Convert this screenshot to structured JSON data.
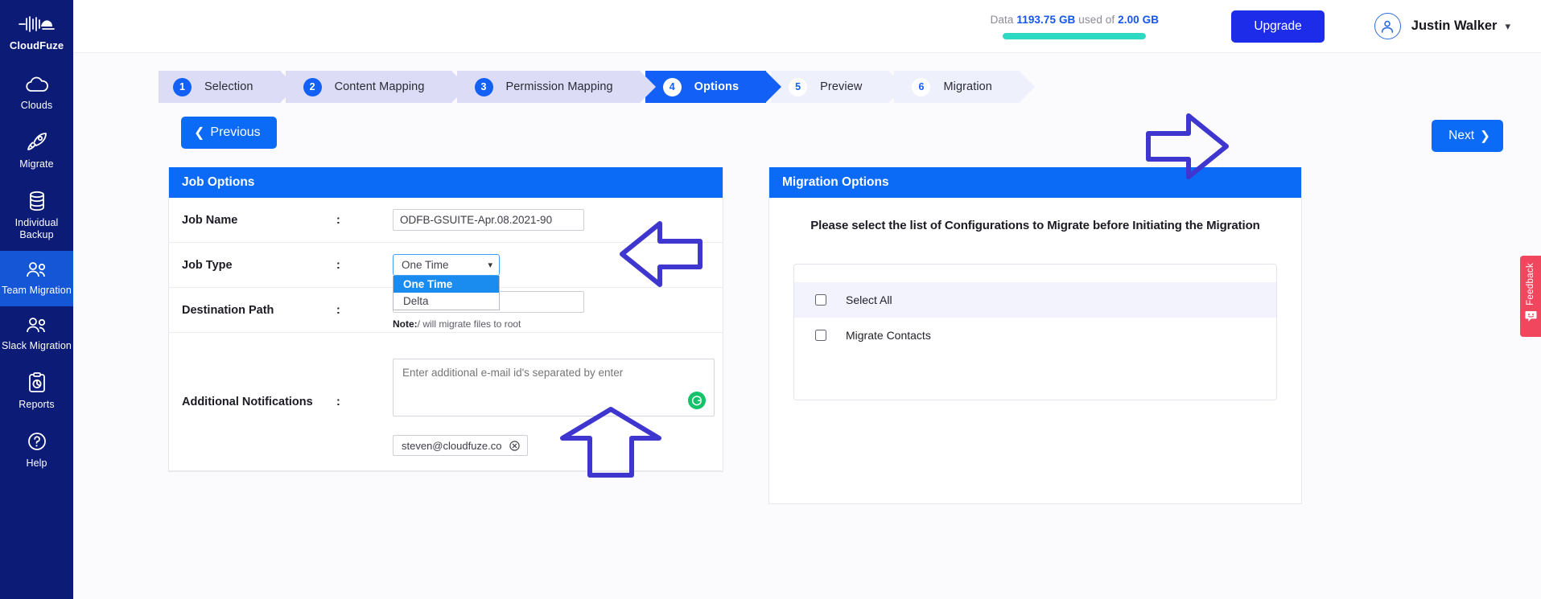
{
  "sidebar": {
    "brand": {
      "label": "CloudFuze",
      "icon": "cloudfuze-logo-icon"
    },
    "items": [
      {
        "label": "Clouds",
        "icon": "cloud-icon",
        "active": false
      },
      {
        "label": "Migrate",
        "icon": "rocket-icon",
        "active": false
      },
      {
        "label": "Individual Backup",
        "icon": "database-icon",
        "active": false
      },
      {
        "label": "Team Migration",
        "icon": "team-icon",
        "active": true
      },
      {
        "label": "Slack Migration",
        "icon": "team-icon",
        "active": false
      },
      {
        "label": "Reports",
        "icon": "clipboard-chart-icon",
        "active": false
      },
      {
        "label": "Help",
        "icon": "question-circle-icon",
        "active": false
      }
    ]
  },
  "header": {
    "data_prefix": "Data",
    "data_used": "1193.75 GB",
    "data_middle": "used of",
    "data_total": "2.00 GB",
    "progress_percent": 100,
    "upgrade_label": "Upgrade",
    "user_name": "Justin Walker",
    "avatar_icon": "user-avatar-icon",
    "caret_icon": "chevron-down-icon",
    "accent_color": "#1456f0",
    "progress_color": "#2ed9c3",
    "upgrade_color": "#1c2ce8"
  },
  "stepper": {
    "steps": [
      {
        "num": "1",
        "label": "Selection",
        "state": "done"
      },
      {
        "num": "2",
        "label": "Content Mapping",
        "state": "done"
      },
      {
        "num": "3",
        "label": "Permission Mapping",
        "state": "done"
      },
      {
        "num": "4",
        "label": "Options",
        "state": "active"
      },
      {
        "num": "5",
        "label": "Preview",
        "state": "pending"
      },
      {
        "num": "6",
        "label": "Migration",
        "state": "pending"
      }
    ]
  },
  "nav": {
    "previous_label": "Previous",
    "next_label": "Next",
    "prev_icon": "chevron-left-icon",
    "next_icon": "chevron-right-icon"
  },
  "job_options": {
    "title": "Job Options",
    "colon": ":",
    "rows": {
      "job_name": {
        "label": "Job Name",
        "value": "ODFB-GSUITE-Apr.08.2021-90",
        "placeholder": "Job Name"
      },
      "job_type": {
        "label": "Job Type",
        "selected": "One Time",
        "options": [
          "One Time",
          "Delta"
        ],
        "open": true,
        "chevron_icon": "chevron-down-icon"
      },
      "destination_path": {
        "label": "Destination Path",
        "value": "",
        "placeholder": "",
        "note_bold": "Note:",
        "note_text": "/ will migrate files to root"
      },
      "additional_notifications": {
        "label": "Additional Notifications",
        "placeholder": "Enter additional e-mail id's separated by enter",
        "value": "",
        "chip": "steven@cloudfuze.co",
        "chip_remove_icon": "close-circle-icon",
        "grammarly_icon": "grammarly-icon"
      }
    }
  },
  "migration_options": {
    "title": "Migration Options",
    "instruction": "Please select the list of Configurations to Migrate before Initiating the Migration",
    "checkboxes": [
      {
        "label": "Select All",
        "checked": false,
        "highlight": true
      },
      {
        "label": "Migrate Contacts",
        "checked": false,
        "highlight": false
      }
    ]
  },
  "feedback": {
    "label": "Feedback",
    "icon": "smiley-chat-icon",
    "color": "#f0475f"
  },
  "annotations": [
    {
      "name": "arrow-pointing-next-button",
      "direction": "right"
    },
    {
      "name": "arrow-pointing-job-type-dropdown",
      "direction": "left"
    },
    {
      "name": "arrow-pointing-email-chip",
      "direction": "up"
    }
  ]
}
